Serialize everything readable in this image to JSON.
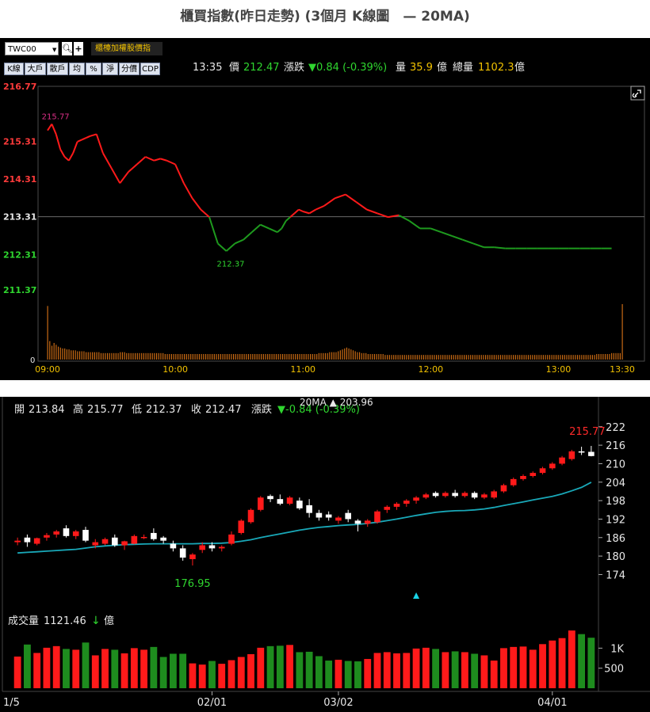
{
  "page_title": "櫃買指數(昨日走勢) (3個月 K線圖　— 20MA)",
  "toolbar": {
    "symbol": "TWC00",
    "search_icon": "magnifier-icon",
    "add_icon": "plus-icon",
    "gold_button": "櫃檯加權股價指",
    "tabs": [
      "K線",
      "大戶",
      "散戶",
      "均",
      "%",
      "淨",
      "分價",
      "CDP"
    ]
  },
  "quote": {
    "time": "13:35",
    "price_label": "價",
    "price": "212.47",
    "change_label": "漲跌",
    "change": "▼0.84 (-0.39%)",
    "volume_label": "量",
    "volume": "35.9",
    "volume_unit": "億",
    "total_label": "總量",
    "total": "1102.3",
    "total_unit": "億"
  },
  "colors": {
    "up": "#ff1a1a",
    "down": "#1e8c1e",
    "ma": "#19a8b8",
    "volume": "#c86a14",
    "text": "#e8e8e8"
  },
  "chart_data": [
    {
      "type": "line",
      "title": "",
      "y_ticks": [
        {
          "label": "216.77",
          "color": "#ff3b3b"
        },
        {
          "label": "215.31",
          "color": "#ff3b3b"
        },
        {
          "label": "214.31",
          "color": "#ff3b3b"
        },
        {
          "label": "213.31",
          "color": "#e8e8e8"
        },
        {
          "label": "212.31",
          "color": "#2fd62f"
        },
        {
          "label": "211.37",
          "color": "#2fd62f"
        }
      ],
      "x_ticks": [
        "09:00",
        "10:00",
        "11:00",
        "12:00",
        "13:00",
        "13:30"
      ],
      "ylim": [
        211.37,
        216.77
      ],
      "reference_close": 213.31,
      "time_range_min": [
        0,
        270
      ],
      "series": [
        {
          "x": [
            0,
            2,
            4,
            6,
            8,
            10,
            12,
            14,
            16,
            18,
            20,
            23,
            26,
            30,
            34,
            38,
            42,
            46,
            50,
            53,
            56,
            60,
            64,
            68,
            72,
            76,
            80,
            84,
            88,
            92,
            96,
            100,
            104,
            108,
            110,
            112,
            114,
            116,
            118,
            120,
            123,
            126,
            130,
            135,
            140,
            145,
            150,
            155,
            160,
            165,
            170,
            175,
            180,
            185,
            190,
            195,
            200,
            205,
            210,
            215,
            220,
            225,
            230,
            235,
            240,
            245,
            250,
            255,
            260,
            265
          ],
          "y": [
            215.6,
            215.77,
            215.5,
            215.1,
            214.9,
            214.8,
            215.0,
            215.3,
            215.35,
            215.4,
            215.45,
            215.5,
            215.0,
            214.6,
            214.2,
            214.5,
            214.7,
            214.9,
            214.8,
            214.85,
            214.8,
            214.7,
            214.2,
            213.8,
            213.5,
            213.3,
            212.6,
            212.4,
            212.6,
            212.7,
            212.9,
            213.1,
            213.0,
            212.9,
            213.0,
            213.2,
            213.3,
            213.4,
            213.5,
            213.45,
            213.4,
            213.5,
            213.6,
            213.8,
            213.9,
            213.7,
            213.5,
            213.4,
            213.3,
            213.35,
            213.2,
            213.0,
            213.0,
            212.9,
            212.8,
            212.7,
            212.6,
            212.5,
            212.5,
            212.47,
            212.47,
            212.47,
            212.47,
            212.47,
            212.47,
            212.47,
            212.47,
            212.47,
            212.47,
            212.47
          ]
        }
      ],
      "annotations": [
        {
          "label": "215.77",
          "x": 1,
          "y": 215.77
        },
        {
          "label": "212.37",
          "x": 84,
          "y": 212.37
        }
      ],
      "volume_axis_label": "0",
      "volume": [
        58,
        20,
        15,
        18,
        16,
        14,
        13,
        12,
        12,
        11,
        11,
        10,
        10,
        10,
        9,
        9,
        9,
        9,
        8,
        8,
        8,
        8,
        8,
        8,
        8,
        7,
        7,
        7,
        7,
        7,
        7,
        7,
        7,
        7,
        8,
        8,
        8,
        7,
        7,
        7,
        7,
        7,
        7,
        7,
        7,
        7,
        7,
        7,
        7,
        7,
        7,
        7,
        7,
        7,
        7,
        6,
        6,
        6,
        6,
        6,
        6,
        6,
        6,
        6,
        6,
        6,
        6,
        6,
        6,
        6,
        6,
        6,
        6,
        6,
        6,
        6,
        6,
        6,
        6,
        6,
        6,
        6,
        6,
        6,
        6,
        6,
        6,
        6,
        6,
        6,
        6,
        6,
        6,
        6,
        6,
        6,
        6,
        6,
        6,
        6,
        6,
        6,
        6,
        6,
        6,
        6,
        6,
        6,
        6,
        6,
        6,
        6,
        6,
        6,
        6,
        6,
        6,
        6,
        6,
        6,
        6,
        6,
        6,
        6,
        6,
        6,
        6,
        7,
        7,
        7,
        7,
        7,
        8,
        8,
        8,
        8,
        9,
        10,
        11,
        12,
        13,
        12,
        11,
        10,
        9,
        8,
        8,
        7,
        7,
        7,
        6,
        6,
        6,
        6,
        6,
        6,
        6,
        6,
        5,
        5,
        5,
        5,
        5,
        5,
        5,
        5,
        5,
        5,
        5,
        5,
        5,
        5,
        5,
        5,
        5,
        5,
        5,
        5,
        5,
        5,
        5,
        5,
        5,
        5,
        5,
        5,
        5,
        5,
        5,
        5,
        5,
        5,
        5,
        5,
        5,
        5,
        5,
        5,
        5,
        5,
        5,
        5,
        5,
        5,
        5,
        5,
        5,
        5,
        5,
        5,
        5,
        5,
        5,
        5,
        5,
        5,
        5,
        5,
        5,
        5,
        5,
        5,
        5,
        5,
        5,
        5,
        5,
        5,
        5,
        5,
        5,
        5,
        5,
        5,
        5,
        5,
        5,
        5,
        5,
        5,
        5,
        5,
        5,
        5,
        5,
        5,
        5,
        5,
        5,
        5,
        5,
        5,
        5,
        5,
        5,
        5,
        5,
        6,
        6,
        6,
        6,
        6,
        6,
        6,
        7,
        7,
        7,
        7,
        7,
        60
      ]
    },
    {
      "type": "candlestick",
      "title": "",
      "header": {
        "open_label": "開",
        "open": "213.84",
        "high_label": "高",
        "high": "215.77",
        "low_label": "低",
        "low": "212.37",
        "close_label": "收",
        "close": "212.47",
        "change_label": "漲跌",
        "change": "▼-0.84 (-0.39%)"
      },
      "ma_label": "20MA ▲ 203.96",
      "ma_value": 203.96,
      "y_ticks": [
        222,
        216,
        210,
        204,
        198,
        192,
        186,
        180,
        174
      ],
      "ylim": [
        170,
        224
      ],
      "x_ticks": [
        {
          "label": "1/5",
          "index": 0
        },
        {
          "label": "02/01",
          "index": 20
        },
        {
          "label": "03/02",
          "index": 33
        },
        {
          "label": "04/01",
          "index": 55
        }
      ],
      "candles": [
        {
          "o": 184.5,
          "h": 186.0,
          "l": 183.5,
          "c": 185.0
        },
        {
          "o": 186.0,
          "h": 187.0,
          "l": 183.0,
          "c": 184.5
        },
        {
          "o": 184.0,
          "h": 186.0,
          "l": 183.5,
          "c": 185.8
        },
        {
          "o": 186.0,
          "h": 187.5,
          "l": 185.0,
          "c": 186.8
        },
        {
          "o": 187.0,
          "h": 188.5,
          "l": 186.0,
          "c": 188.0
        },
        {
          "o": 189.0,
          "h": 190.0,
          "l": 186.0,
          "c": 186.5
        },
        {
          "o": 186.5,
          "h": 188.5,
          "l": 185.5,
          "c": 188.0
        },
        {
          "o": 188.5,
          "h": 189.5,
          "l": 184.5,
          "c": 185.0
        },
        {
          "o": 183.5,
          "h": 185.5,
          "l": 182.5,
          "c": 184.5
        },
        {
          "o": 184.0,
          "h": 186.0,
          "l": 183.5,
          "c": 185.5
        },
        {
          "o": 186.0,
          "h": 187.0,
          "l": 183.0,
          "c": 183.5
        },
        {
          "o": 183.5,
          "h": 185.0,
          "l": 182.0,
          "c": 184.8
        },
        {
          "o": 184.0,
          "h": 187.0,
          "l": 183.8,
          "c": 186.5
        },
        {
          "o": 186.0,
          "h": 187.0,
          "l": 185.5,
          "c": 186.2
        },
        {
          "o": 187.5,
          "h": 189.0,
          "l": 185.0,
          "c": 185.5
        },
        {
          "o": 186.0,
          "h": 186.5,
          "l": 184.0,
          "c": 185.0
        },
        {
          "o": 184.0,
          "h": 185.0,
          "l": 181.5,
          "c": 182.5
        },
        {
          "o": 182.5,
          "h": 183.5,
          "l": 178.5,
          "c": 179.5
        },
        {
          "o": 179.0,
          "h": 181.0,
          "l": 176.95,
          "c": 180.5
        },
        {
          "o": 182.0,
          "h": 184.5,
          "l": 181.0,
          "c": 183.5
        },
        {
          "o": 183.5,
          "h": 184.5,
          "l": 181.5,
          "c": 182.5
        },
        {
          "o": 182.5,
          "h": 183.5,
          "l": 181.5,
          "c": 183.0
        },
        {
          "o": 184.0,
          "h": 188.0,
          "l": 183.5,
          "c": 187.0
        },
        {
          "o": 187.5,
          "h": 192.0,
          "l": 187.0,
          "c": 191.5
        },
        {
          "o": 191.0,
          "h": 195.5,
          "l": 190.5,
          "c": 195.0
        },
        {
          "o": 195.0,
          "h": 199.5,
          "l": 194.5,
          "c": 199.0
        },
        {
          "o": 199.5,
          "h": 200.0,
          "l": 197.5,
          "c": 198.5
        },
        {
          "o": 198.5,
          "h": 200.0,
          "l": 196.5,
          "c": 197.0
        },
        {
          "o": 197.0,
          "h": 199.5,
          "l": 196.5,
          "c": 199.0
        },
        {
          "o": 198.0,
          "h": 199.0,
          "l": 195.0,
          "c": 195.5
        },
        {
          "o": 196.5,
          "h": 198.5,
          "l": 192.5,
          "c": 194.0
        },
        {
          "o": 194.0,
          "h": 195.0,
          "l": 191.5,
          "c": 192.5
        },
        {
          "o": 193.5,
          "h": 194.5,
          "l": 191.5,
          "c": 192.5
        },
        {
          "o": 191.5,
          "h": 193.0,
          "l": 190.5,
          "c": 192.5
        },
        {
          "o": 194.0,
          "h": 195.0,
          "l": 191.0,
          "c": 192.0
        },
        {
          "o": 191.5,
          "h": 192.0,
          "l": 188.0,
          "c": 190.5
        },
        {
          "o": 190.5,
          "h": 192.0,
          "l": 189.5,
          "c": 191.5
        },
        {
          "o": 191.0,
          "h": 195.0,
          "l": 190.5,
          "c": 194.5
        },
        {
          "o": 195.0,
          "h": 196.5,
          "l": 194.0,
          "c": 196.0
        },
        {
          "o": 196.0,
          "h": 197.5,
          "l": 195.0,
          "c": 197.0
        },
        {
          "o": 197.0,
          "h": 198.5,
          "l": 196.0,
          "c": 198.0
        },
        {
          "o": 198.0,
          "h": 199.5,
          "l": 197.0,
          "c": 199.0
        },
        {
          "o": 199.0,
          "h": 200.5,
          "l": 198.5,
          "c": 200.0
        },
        {
          "o": 200.5,
          "h": 201.0,
          "l": 199.0,
          "c": 199.5
        },
        {
          "o": 199.5,
          "h": 201.0,
          "l": 199.0,
          "c": 200.5
        },
        {
          "o": 200.5,
          "h": 201.5,
          "l": 199.0,
          "c": 199.5
        },
        {
          "o": 199.5,
          "h": 201.0,
          "l": 199.0,
          "c": 200.5
        },
        {
          "o": 200.5,
          "h": 201.0,
          "l": 198.5,
          "c": 199.0
        },
        {
          "o": 199.0,
          "h": 200.5,
          "l": 198.5,
          "c": 200.0
        },
        {
          "o": 199.0,
          "h": 201.5,
          "l": 198.5,
          "c": 201.0
        },
        {
          "o": 201.0,
          "h": 203.5,
          "l": 200.5,
          "c": 203.0
        },
        {
          "o": 203.0,
          "h": 205.5,
          "l": 202.5,
          "c": 205.0
        },
        {
          "o": 205.0,
          "h": 206.5,
          "l": 204.5,
          "c": 206.0
        },
        {
          "o": 206.0,
          "h": 207.5,
          "l": 205.5,
          "c": 207.0
        },
        {
          "o": 207.0,
          "h": 209.0,
          "l": 206.5,
          "c": 208.5
        },
        {
          "o": 208.5,
          "h": 210.5,
          "l": 208.0,
          "c": 210.0
        },
        {
          "o": 210.0,
          "h": 212.5,
          "l": 209.5,
          "c": 212.0
        },
        {
          "o": 211.5,
          "h": 214.5,
          "l": 211.0,
          "c": 214.0
        },
        {
          "o": 214.0,
          "h": 215.5,
          "l": 212.8,
          "c": 213.6
        },
        {
          "o": 213.84,
          "h": 215.77,
          "l": 212.37,
          "c": 212.47
        }
      ],
      "ma": [
        181.0,
        181.2,
        181.4,
        181.6,
        181.8,
        182.0,
        182.2,
        182.6,
        183.0,
        183.3,
        183.5,
        183.7,
        183.8,
        183.9,
        184.0,
        184.0,
        184.0,
        184.0,
        184.0,
        184.1,
        184.1,
        184.2,
        184.4,
        184.8,
        185.3,
        186.0,
        186.6,
        187.2,
        187.8,
        188.4,
        188.9,
        189.3,
        189.6,
        189.9,
        190.1,
        190.3,
        190.6,
        191.0,
        191.5,
        192.0,
        192.6,
        193.2,
        193.7,
        194.2,
        194.5,
        194.7,
        194.8,
        195.0,
        195.3,
        195.8,
        196.4,
        197.0,
        197.6,
        198.2,
        198.8,
        199.4,
        200.2,
        201.2,
        202.3,
        203.96
      ],
      "high_annotation": {
        "label": "215.77",
        "index": 59
      },
      "low_annotation": {
        "label": "176.95",
        "index": 18
      },
      "marker_index": 41,
      "volume_label": "成交量",
      "volume_value": "1121.46",
      "volume_arrow": "↓",
      "volume_unit": "億",
      "volume_ticks": [
        "1K",
        "500"
      ],
      "volume_ylim": [
        0,
        1600
      ],
      "volumes": [
        790,
        1090,
        880,
        1010,
        1050,
        980,
        960,
        1140,
        820,
        980,
        960,
        870,
        1000,
        960,
        1030,
        780,
        860,
        860,
        620,
        590,
        680,
        610,
        700,
        780,
        850,
        1010,
        1050,
        1060,
        1080,
        900,
        910,
        800,
        690,
        710,
        680,
        670,
        730,
        880,
        900,
        870,
        880,
        990,
        1010,
        980,
        900,
        920,
        900,
        860,
        820,
        690,
        1000,
        1030,
        1040,
        960,
        1100,
        1190,
        1250,
        1440,
        1350,
        1260
      ]
    }
  ]
}
